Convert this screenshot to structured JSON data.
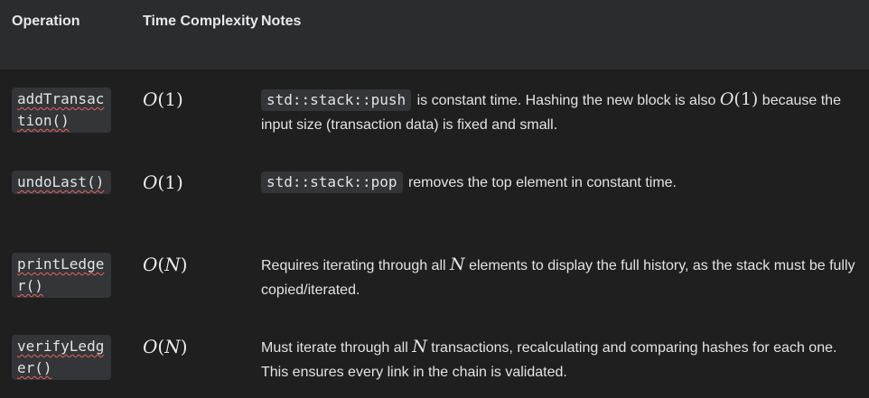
{
  "table": {
    "headers": {
      "operation": "Operation",
      "complexity": "Time Complexity",
      "notes": "Notes"
    },
    "rows": [
      {
        "operation": "addTransaction()",
        "complexity_open": "O(",
        "complexity_var": "1",
        "complexity_close": ")",
        "note_code": "std::stack::push",
        "note_text_1": " is constant time. Hashing the new block is also ",
        "note_math": "O(1)",
        "note_text_2": " because the input size (transaction data) is fixed and small."
      },
      {
        "operation": "undoLast()",
        "complexity_open": "O(",
        "complexity_var": "1",
        "complexity_close": ")",
        "note_code": "std::stack::pop",
        "note_text_1": " removes the top element in constant time."
      },
      {
        "operation": "printLedger()",
        "complexity_open": "O(",
        "complexity_var": "N",
        "complexity_close": ")",
        "note_text_1": "Requires iterating through all ",
        "note_var": "N",
        "note_text_2": " elements to display the full history, as the stack must be fully copied/iterated."
      },
      {
        "operation": "verifyLedger()",
        "complexity_open": "O(",
        "complexity_var": "N",
        "complexity_close": ")",
        "note_text_1": "Must iterate through all ",
        "note_var": "N",
        "note_text_2": " transactions, recalculating and comparing hashes for each one. This ensures every link in the chain is validated."
      }
    ]
  }
}
